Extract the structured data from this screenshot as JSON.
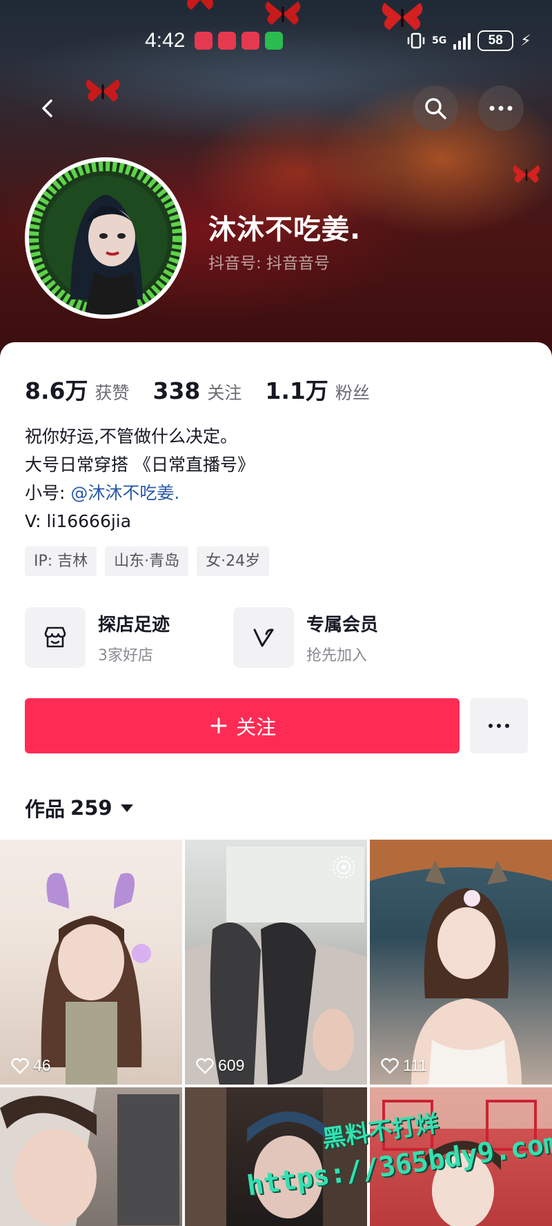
{
  "status_bar": {
    "time": "4:42",
    "network": "5G",
    "battery": "58"
  },
  "profile": {
    "nickname": "沐沐不吃姜.",
    "douyin_id": "抖音号: 抖音音号"
  },
  "stats": [
    {
      "value": "8.6万",
      "label": "获赞"
    },
    {
      "value": "338",
      "label": "关注"
    },
    {
      "value": "1.1万",
      "label": "粉丝"
    }
  ],
  "bio": {
    "line1": "祝你好运,不管做什么决定。",
    "line2": "大号日常穿搭 《日常直播号》",
    "line3_prefix": "小号: ",
    "line3_mention": "@沐沐不吃姜.",
    "line4": "V:  li16666jia"
  },
  "tags": [
    "IP:  吉林",
    "山东·青岛",
    "女·24岁"
  ],
  "features": [
    {
      "title": "探店足迹",
      "subtitle": "3家好店",
      "icon": "shop-icon"
    },
    {
      "title": "专属会员",
      "subtitle": "抢先加入",
      "icon": "vip-v-icon"
    }
  ],
  "follow_label": "关注",
  "works": {
    "label": "作品",
    "count": "259"
  },
  "videos": [
    {
      "likes": "46"
    },
    {
      "likes": "609"
    },
    {
      "likes": "111"
    },
    {
      "likes": ""
    },
    {
      "likes": ""
    },
    {
      "likes": ""
    }
  ],
  "watermark": {
    "line1": "黑料不打烊",
    "line2": "https://365bdy9.com"
  },
  "colors": {
    "accent": "#fe2c55",
    "mention": "#2a5aa8",
    "watermark": "#35e0b0"
  }
}
